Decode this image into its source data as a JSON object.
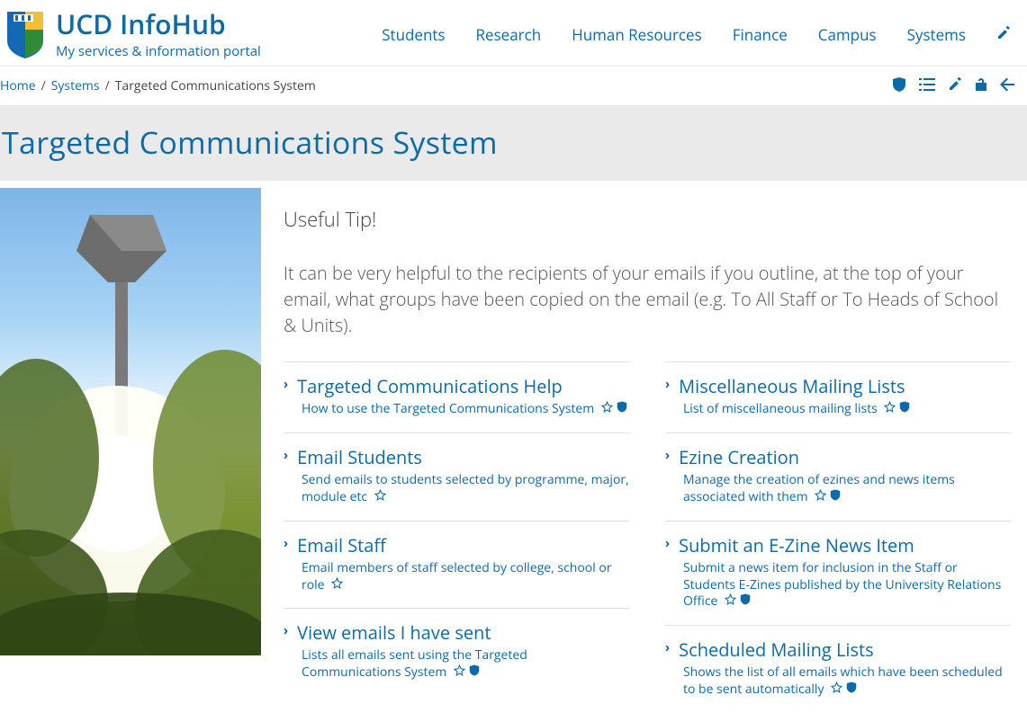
{
  "site": {
    "title": "UCD InfoHub",
    "tagline": "My services & information portal"
  },
  "nav": [
    {
      "label": "Students"
    },
    {
      "label": "Research"
    },
    {
      "label": "Human Resources"
    },
    {
      "label": "Finance"
    },
    {
      "label": "Campus"
    },
    {
      "label": "Systems"
    }
  ],
  "breadcrumb": {
    "home": "Home",
    "section": "Systems",
    "current": "Targeted Communications System"
  },
  "page_title": "Targeted Communications System",
  "tip": {
    "label": "Useful Tip!",
    "body": "It can be very helpful to the recipients of your emails if you outline, at the top of your email, what groups have been copied on the email (e.g. To All Staff or To Heads of School & Units)."
  },
  "left_items": [
    {
      "title": "Targeted Communications Help",
      "desc": "How to use the Targeted Communications System",
      "star": true,
      "shield": true
    },
    {
      "title": "Email Students",
      "desc": "Send emails to students selected by programme, major, module etc",
      "star": true,
      "shield": false
    },
    {
      "title": "Email Staff",
      "desc": "Email members of staff selected by college, school or role",
      "star": true,
      "shield": false
    },
    {
      "title": "View emails I have sent",
      "desc": "Lists all emails sent using the Targeted Communications System",
      "star": true,
      "shield": true
    }
  ],
  "right_items": [
    {
      "title": "Miscellaneous Mailing Lists",
      "desc": "List of miscellaneous mailing lists",
      "star": true,
      "shield": true
    },
    {
      "title": "Ezine Creation",
      "desc": "Manage the creation of ezines and news items associated with them",
      "star": true,
      "shield": true
    },
    {
      "title": "Submit an E-Zine News Item",
      "desc": "Submit a news item for inclusion in the Staff or Students E-Zines published by the University Relations Office",
      "star": true,
      "shield": true
    },
    {
      "title": "Scheduled Mailing Lists",
      "desc": "Shows the list of all emails which have been scheduled to be sent automatically",
      "star": true,
      "shield": true
    }
  ]
}
